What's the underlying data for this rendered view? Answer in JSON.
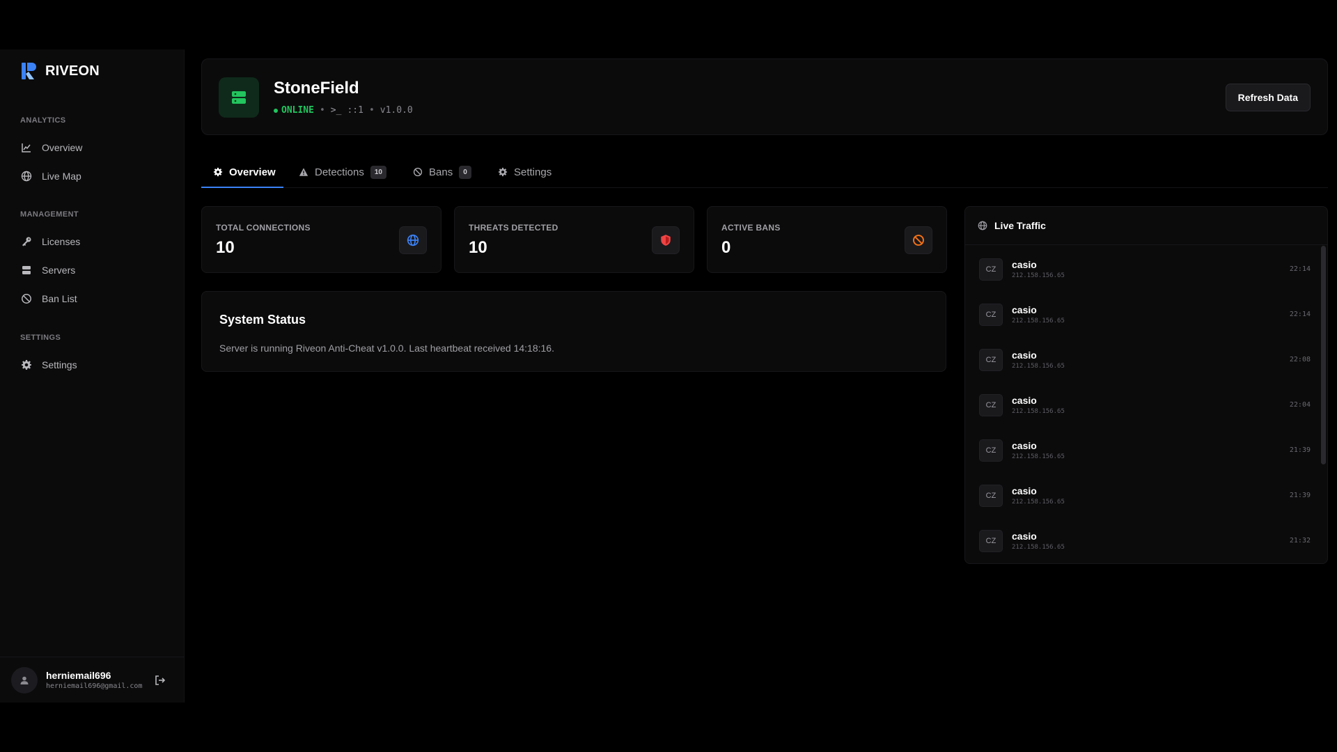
{
  "brand": {
    "name": "RIVEON"
  },
  "sidebar": {
    "sections": [
      {
        "label": "ANALYTICS"
      },
      {
        "label": "MANAGEMENT"
      },
      {
        "label": "SETTINGS"
      }
    ],
    "items": [
      {
        "label": "Overview",
        "icon": "chart-line-icon"
      },
      {
        "label": "Live Map",
        "icon": "globe-icon"
      },
      {
        "label": "Licenses",
        "icon": "key-icon"
      },
      {
        "label": "Servers",
        "icon": "server-icon"
      },
      {
        "label": "Ban List",
        "icon": "ban-icon"
      },
      {
        "label": "Settings",
        "icon": "gear-icon"
      }
    ],
    "user": {
      "name": "herniemail696",
      "email": "herniemail696@gmail.com"
    }
  },
  "header": {
    "title": "StoneField",
    "status": "ONLINE",
    "address": "::1",
    "version": "v1.0.0",
    "refresh_label": "Refresh Data"
  },
  "tabs": [
    {
      "label": "Overview",
      "icon": "gear-icon"
    },
    {
      "label": "Detections",
      "badge": "10",
      "icon": "warning-icon"
    },
    {
      "label": "Bans",
      "badge": "0",
      "icon": "ban-icon"
    },
    {
      "label": "Settings",
      "icon": "gear-icon"
    }
  ],
  "stats": [
    {
      "label": "TOTAL CONNECTIONS",
      "value": "10",
      "icon": "globe-icon",
      "color": "#3b82f6"
    },
    {
      "label": "THREATS DETECTED",
      "value": "10",
      "icon": "shield-icon",
      "color": "#ef4444"
    },
    {
      "label": "ACTIVE BANS",
      "value": "0",
      "icon": "ban-icon",
      "color": "#f97316"
    }
  ],
  "system_status": {
    "title": "System Status",
    "text": "Server is running Riveon Anti-Cheat v1.0.0. Last heartbeat received 14:18:16."
  },
  "traffic": {
    "title": "Live Traffic",
    "rows": [
      {
        "country": "CZ",
        "name": "casio",
        "ip": "212.158.156.65",
        "time": "22:14"
      },
      {
        "country": "CZ",
        "name": "casio",
        "ip": "212.158.156.65",
        "time": "22:14"
      },
      {
        "country": "CZ",
        "name": "casio",
        "ip": "212.158.156.65",
        "time": "22:08"
      },
      {
        "country": "CZ",
        "name": "casio",
        "ip": "212.158.156.65",
        "time": "22:04"
      },
      {
        "country": "CZ",
        "name": "casio",
        "ip": "212.158.156.65",
        "time": "21:39"
      },
      {
        "country": "CZ",
        "name": "casio",
        "ip": "212.158.156.65",
        "time": "21:39"
      },
      {
        "country": "CZ",
        "name": "casio",
        "ip": "212.158.156.65",
        "time": "21:32"
      }
    ]
  },
  "colors": {
    "accent": "#3b82f6",
    "online": "#22c55e",
    "threat": "#ef4444",
    "ban": "#f97316"
  }
}
